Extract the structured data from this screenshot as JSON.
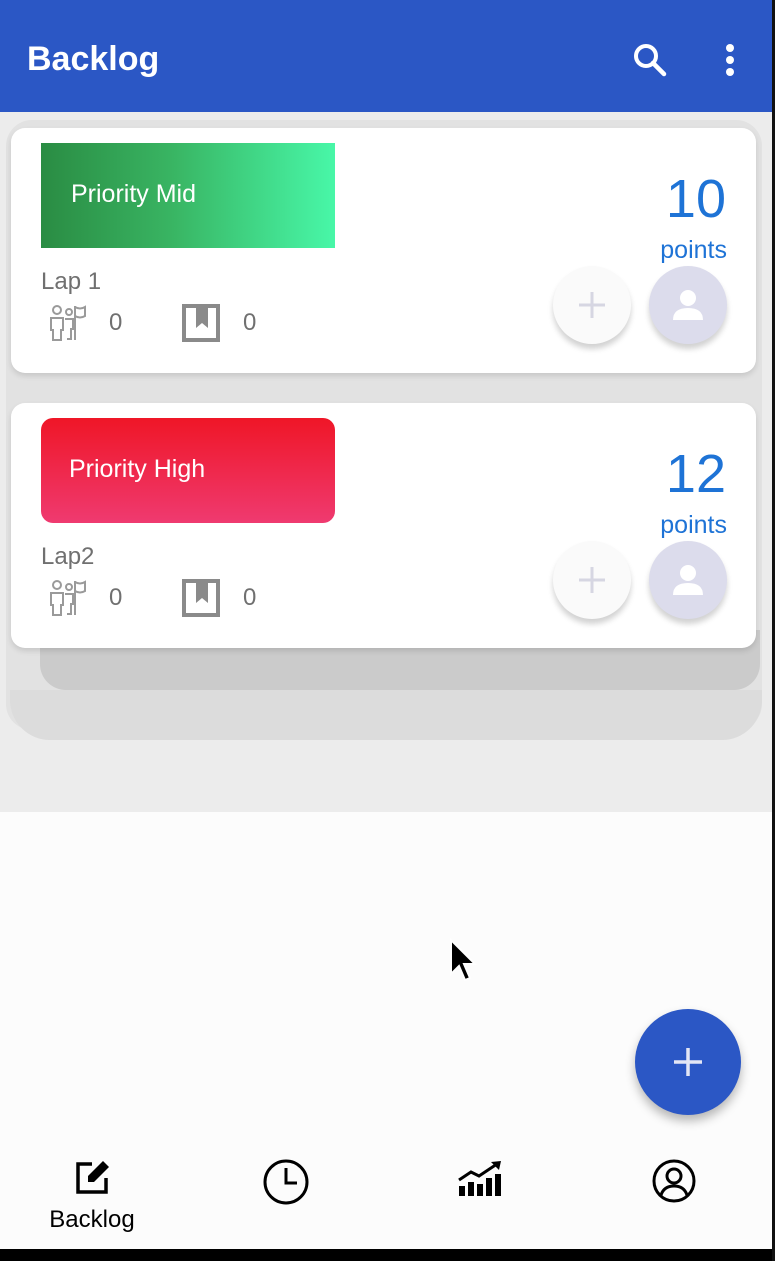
{
  "app_bar": {
    "title": "Backlog",
    "search_icon": "search-icon",
    "more_icon": "more-vert-icon",
    "color": "#2b57c5"
  },
  "cards": [
    {
      "priority": "Priority Mid",
      "name": "Lap 1",
      "members": "0",
      "tasks": "0",
      "points": "10",
      "points_label": "points",
      "priority_color": "#39b563"
    },
    {
      "priority": "Priority High",
      "name": "Lap2",
      "members": "0",
      "tasks": "0",
      "points": "12",
      "points_label": "points",
      "priority_color": "#ef2a50"
    }
  ],
  "fab": {
    "icon": "plus-icon"
  },
  "bottom_nav": [
    {
      "icon": "edit-icon",
      "label": "Backlog",
      "active": true
    },
    {
      "icon": "clock-icon",
      "label": ""
    },
    {
      "icon": "chart-icon",
      "label": ""
    },
    {
      "icon": "account-icon",
      "label": ""
    }
  ]
}
